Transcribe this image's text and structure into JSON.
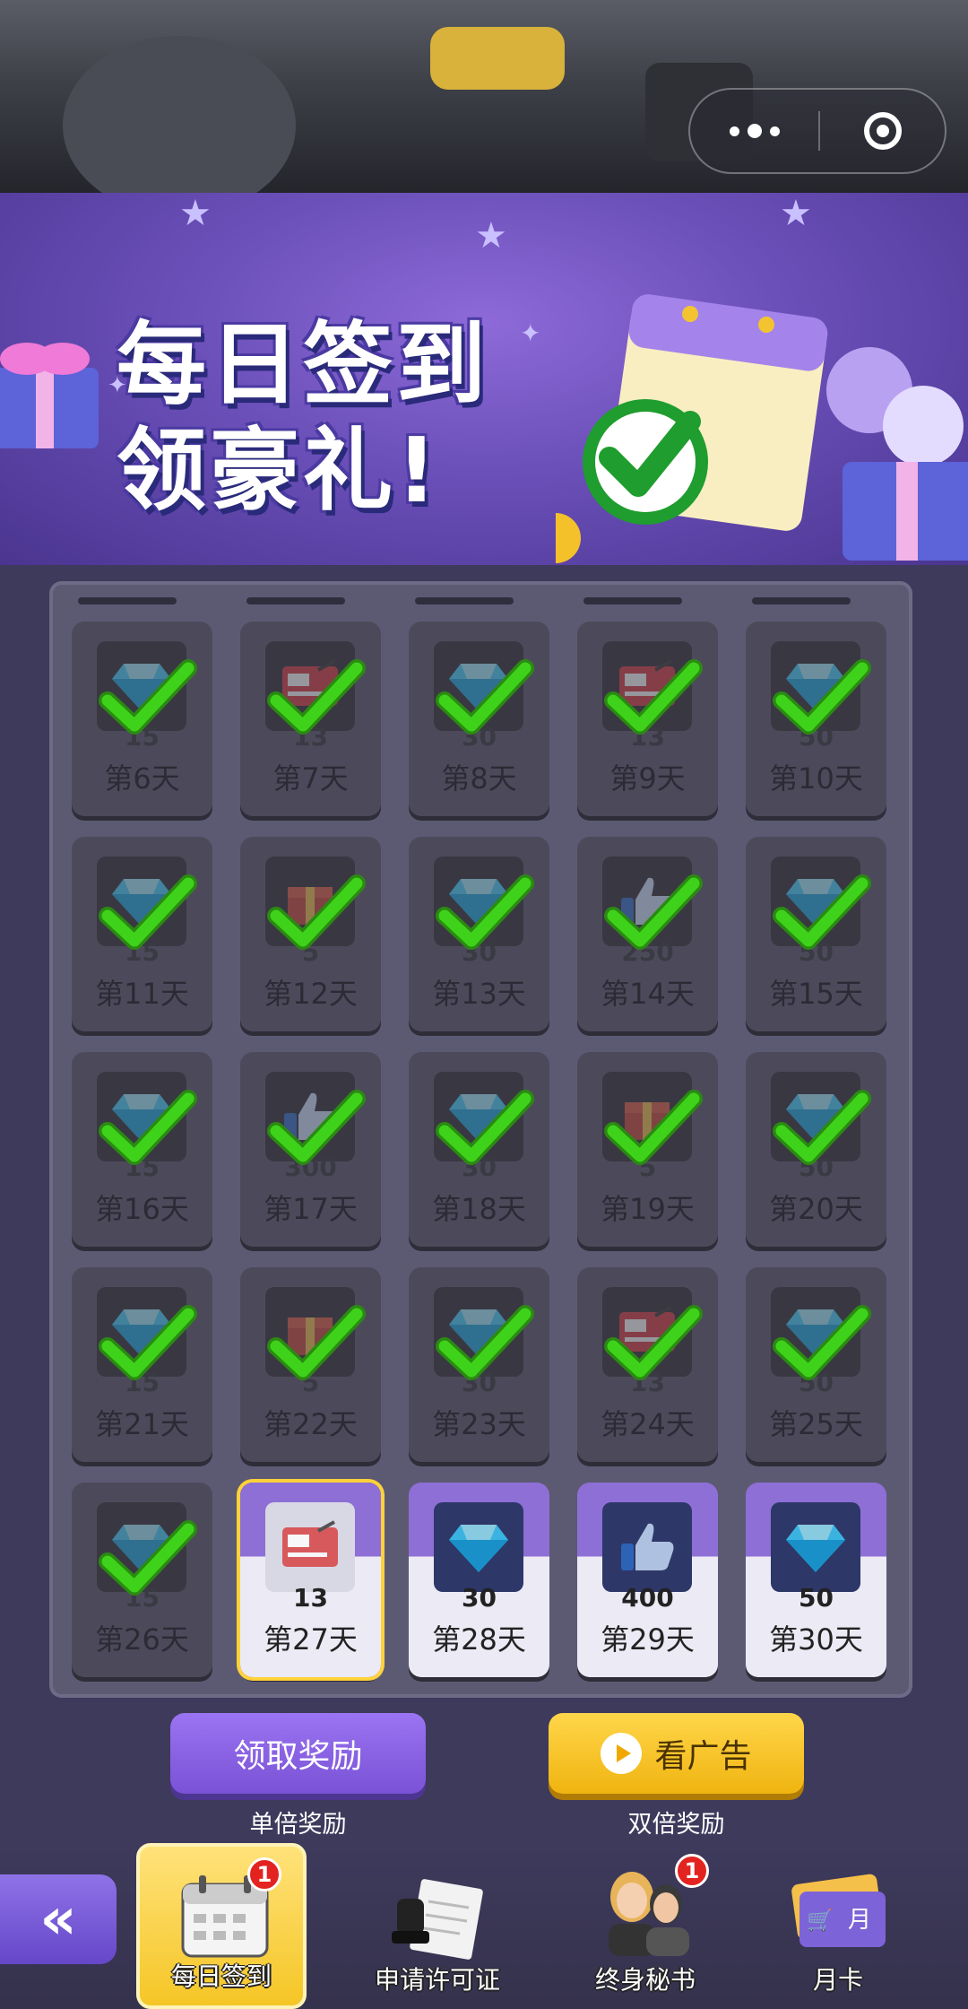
{
  "banner": {
    "line1": "每日签到",
    "line2": "领豪礼!"
  },
  "grid": {
    "cells": [
      {
        "amount": "15",
        "day": "第6天",
        "state": "claimed",
        "icon": "gem-icon"
      },
      {
        "amount": "13",
        "day": "第7天",
        "state": "claimed",
        "icon": "card-icon"
      },
      {
        "amount": "30",
        "day": "第8天",
        "state": "claimed",
        "icon": "gem-icon"
      },
      {
        "amount": "13",
        "day": "第9天",
        "state": "claimed",
        "icon": "card-icon"
      },
      {
        "amount": "50",
        "day": "第10天",
        "state": "claimed",
        "icon": "gem-icon"
      },
      {
        "amount": "15",
        "day": "第11天",
        "state": "claimed",
        "icon": "gem-icon"
      },
      {
        "amount": "5",
        "day": "第12天",
        "state": "claimed",
        "icon": "box-icon"
      },
      {
        "amount": "30",
        "day": "第13天",
        "state": "claimed",
        "icon": "gem-icon"
      },
      {
        "amount": "250",
        "day": "第14天",
        "state": "claimed",
        "icon": "thumbs-up-icon"
      },
      {
        "amount": "50",
        "day": "第15天",
        "state": "claimed",
        "icon": "gem-icon"
      },
      {
        "amount": "15",
        "day": "第16天",
        "state": "claimed",
        "icon": "gem-icon"
      },
      {
        "amount": "300",
        "day": "第17天",
        "state": "claimed",
        "icon": "thumbs-up-icon"
      },
      {
        "amount": "30",
        "day": "第18天",
        "state": "claimed",
        "icon": "gem-icon"
      },
      {
        "amount": "5",
        "day": "第19天",
        "state": "claimed",
        "icon": "box-icon"
      },
      {
        "amount": "50",
        "day": "第20天",
        "state": "claimed",
        "icon": "gem-icon"
      },
      {
        "amount": "15",
        "day": "第21天",
        "state": "claimed",
        "icon": "gem-icon"
      },
      {
        "amount": "5",
        "day": "第22天",
        "state": "claimed",
        "icon": "box-icon"
      },
      {
        "amount": "30",
        "day": "第23天",
        "state": "claimed",
        "icon": "gem-icon"
      },
      {
        "amount": "13",
        "day": "第24天",
        "state": "claimed",
        "icon": "card-icon"
      },
      {
        "amount": "50",
        "day": "第25天",
        "state": "claimed",
        "icon": "gem-icon"
      },
      {
        "amount": "15",
        "day": "第26天",
        "state": "claimed",
        "icon": "gem-icon"
      },
      {
        "amount": "13",
        "day": "第27天",
        "state": "current",
        "icon": "card-icon"
      },
      {
        "amount": "30",
        "day": "第28天",
        "state": "upcoming",
        "icon": "gem-icon"
      },
      {
        "amount": "400",
        "day": "第29天",
        "state": "upcoming",
        "icon": "thumbs-up-icon"
      },
      {
        "amount": "50",
        "day": "第30天",
        "state": "upcoming",
        "icon": "gem-icon"
      }
    ]
  },
  "actions": {
    "claim_label": "领取奖励",
    "claim_sub": "单倍奖励",
    "ad_label": "看广告",
    "ad_sub": "双倍奖励"
  },
  "tabs": [
    {
      "label": "每日签到",
      "badge": "1",
      "active": true,
      "icon": "calendar-icon"
    },
    {
      "label": "申请许可证",
      "badge": "",
      "active": false,
      "icon": "stamp-icon"
    },
    {
      "label": "终身秘书",
      "badge": "1",
      "active": false,
      "icon": "secretary-icon"
    },
    {
      "label": "月卡",
      "badge": "",
      "active": false,
      "icon": "month-card-icon"
    }
  ],
  "month_card_text": "月",
  "back_glyph": "«",
  "colors": {
    "accent_purple": "#8d6fd6",
    "accent_yellow": "#f5c626",
    "check_green": "#3fd21a",
    "badge_red": "#e3231f"
  }
}
